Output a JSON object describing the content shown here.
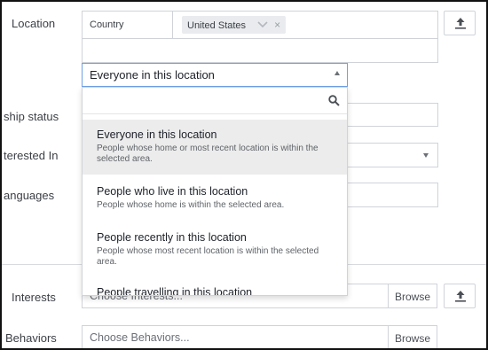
{
  "labels": {
    "location": "Location",
    "relationship": "ship status",
    "interested": "terested In",
    "languages": "anguages",
    "interests": "Interests",
    "behaviors": "Behaviors"
  },
  "location": {
    "country_label": "Country",
    "selected_country": "United States"
  },
  "audience_dropdown": {
    "selected": "Everyone in this location",
    "options": [
      {
        "title": "Everyone in this location",
        "desc": "People whose home or most recent location is within the selected area."
      },
      {
        "title": "People who live in this location",
        "desc": "People whose home is within the selected area."
      },
      {
        "title": "People recently in this location",
        "desc": "People whose most recent location is within the selected area."
      },
      {
        "title": "People travelling in this location",
        "desc": ""
      }
    ]
  },
  "interests": {
    "placeholder": "Choose Interests...",
    "browse_label": "Browse"
  },
  "behaviors": {
    "placeholder": "Choose Behaviors...",
    "browse_label": "Browse"
  }
}
